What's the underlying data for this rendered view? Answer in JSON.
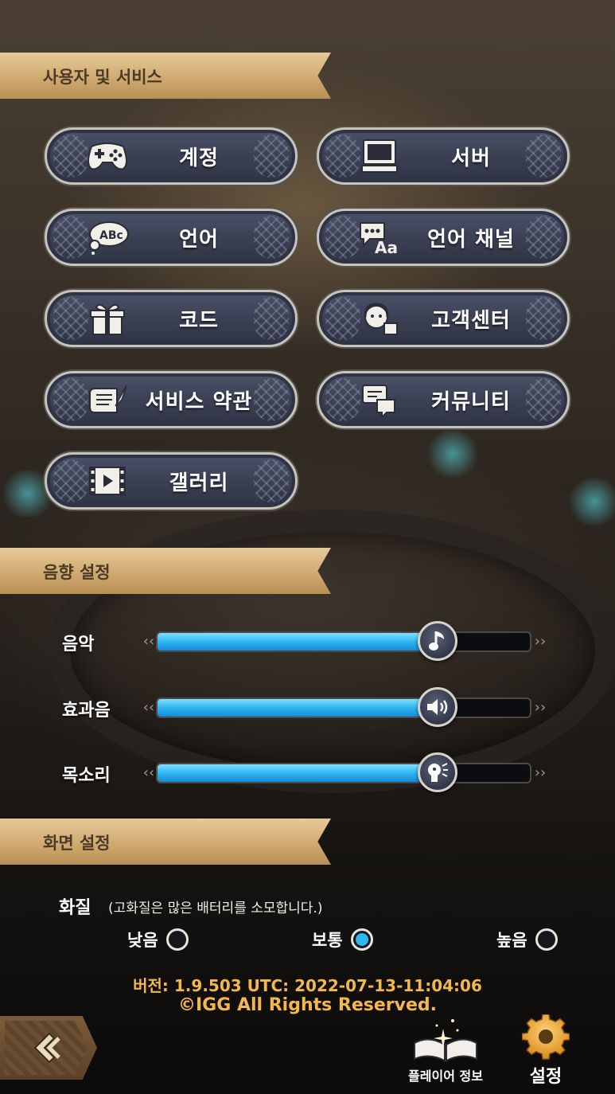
{
  "sections": {
    "user_services": "사용자 및 서비스",
    "sound": "음향 설정",
    "display": "화면 설정"
  },
  "menu": {
    "account": "계정",
    "server": "서버",
    "language": "언어",
    "language_channel": "언어 채널",
    "code": "코드",
    "support": "고객센터",
    "terms": "서비스 약관",
    "community": "커뮤니티",
    "gallery": "갤러리"
  },
  "sound": {
    "music": {
      "label": "음악",
      "level": 0.75
    },
    "effects": {
      "label": "효과음",
      "level": 0.75
    },
    "voice": {
      "label": "목소리",
      "level": 0.75
    }
  },
  "display": {
    "quality_label": "화질",
    "quality_note": "(고화질은 많은 배터리를 소모합니다.)",
    "options": [
      "낮음",
      "보통",
      "높음"
    ],
    "selected": "보통"
  },
  "footer": {
    "version": "버전: 1.9.503  UTC: 2022-07-13-11:04:06",
    "copyright": "©IGG All Rights Reserved."
  },
  "tabs": {
    "player_info": "플레이어 정보",
    "settings": "설정"
  },
  "colors": {
    "accent": "#2fb6f3",
    "banner": "#d2ad74",
    "gold_text": "#f3b74a"
  }
}
